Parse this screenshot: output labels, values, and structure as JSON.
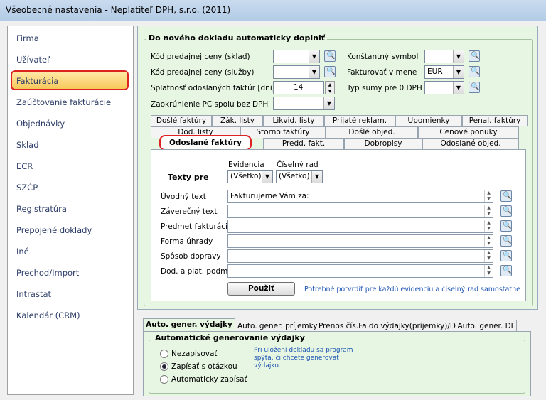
{
  "window": {
    "title": "Všeobecné nastavenia - Neplatiteľ DPH, s.r.o. (2011)"
  },
  "sidebar": {
    "items": [
      {
        "label": "Firma"
      },
      {
        "label": "Užívateľ"
      },
      {
        "label": "Fakturácia"
      },
      {
        "label": "Zaúčtovanie fakturácie"
      },
      {
        "label": "Objednávky"
      },
      {
        "label": "Sklad"
      },
      {
        "label": "ECR"
      },
      {
        "label": "SZČP"
      },
      {
        "label": "Registratúra"
      },
      {
        "label": "Prepojené doklady"
      },
      {
        "label": "Iné"
      },
      {
        "label": "Prechod/Import"
      },
      {
        "label": "Intrastat"
      },
      {
        "label": "Kalendár (CRM)"
      }
    ],
    "selected": "Fakturácia"
  },
  "autofill": {
    "title": "Do nového dokladu automaticky doplniť",
    "kod_sklad": {
      "label": "Kód predajnej ceny (sklad)",
      "value": ""
    },
    "kod_sluzby": {
      "label": "Kód predajnej ceny (služby)",
      "value": ""
    },
    "splatnost": {
      "label": "Splatnosť odoslaných faktúr [dni]",
      "value": "14"
    },
    "zaokruhlenie": {
      "label": "Zaokrúhlenie PC spolu bez DPH",
      "value": ""
    },
    "konst_symbol": {
      "label": "Konštantný symbol",
      "value": ""
    },
    "mena": {
      "label": "Fakturovať v mene",
      "value": "EUR"
    },
    "typ_sumy": {
      "label": "Typ sumy pre 0 DPH",
      "value": ""
    }
  },
  "tabs": {
    "row1": [
      "Došlé faktúry",
      "Zák. listy",
      "Likvid. listy",
      "Prijaté reklam.",
      "Upomienky",
      "Penal. faktúry"
    ],
    "row2": [
      "Dod. listy",
      "Storno faktúry",
      "Došlé objed.",
      "Cenové ponuky"
    ],
    "row3": [
      "Odoslané faktúry",
      "Predd. fakt.",
      "Dobropisy",
      "Odoslané objed."
    ],
    "active": "Odoslané faktúry"
  },
  "texts": {
    "texty_pre": "Texty pre",
    "evidencia_label": "Evidencia",
    "evidencia_value": "(Všetko)",
    "rad_label": "Číselný rad",
    "rad_value": "(Všetko)",
    "rows": [
      {
        "label": "Úvodný text",
        "value": "Fakturujeme Vám za:"
      },
      {
        "label": "Záverečný text",
        "value": ""
      },
      {
        "label": "Predmet fakturácie",
        "value": ""
      },
      {
        "label": "Forma úhrady",
        "value": ""
      },
      {
        "label": "Spôsob dopravy",
        "value": ""
      },
      {
        "label": "Dod. a plat. podm.",
        "value": ""
      }
    ],
    "apply_button": "Použiť",
    "hint": "Potrebné potvrdiť pre každú evidenciu a číselný rad samostatne"
  },
  "bottom": {
    "tabs": [
      "Auto. gener. výdajky",
      "Auto. gener. príjemky",
      "Prenos čís.Fa do výdajky(príjemky)/DL",
      "Auto. gener. DL"
    ],
    "active_tab": "Auto. gener. výdajky",
    "group_title": "Automatické generovanie výdajky",
    "options": [
      "Nezapisovať",
      "Zapísať s otázkou",
      "Automaticky zapísať"
    ],
    "selected_option": "Zapísať s otázkou",
    "hint": "Pri uložení dokladu sa program spýta, či chcete generovať výdajku."
  }
}
